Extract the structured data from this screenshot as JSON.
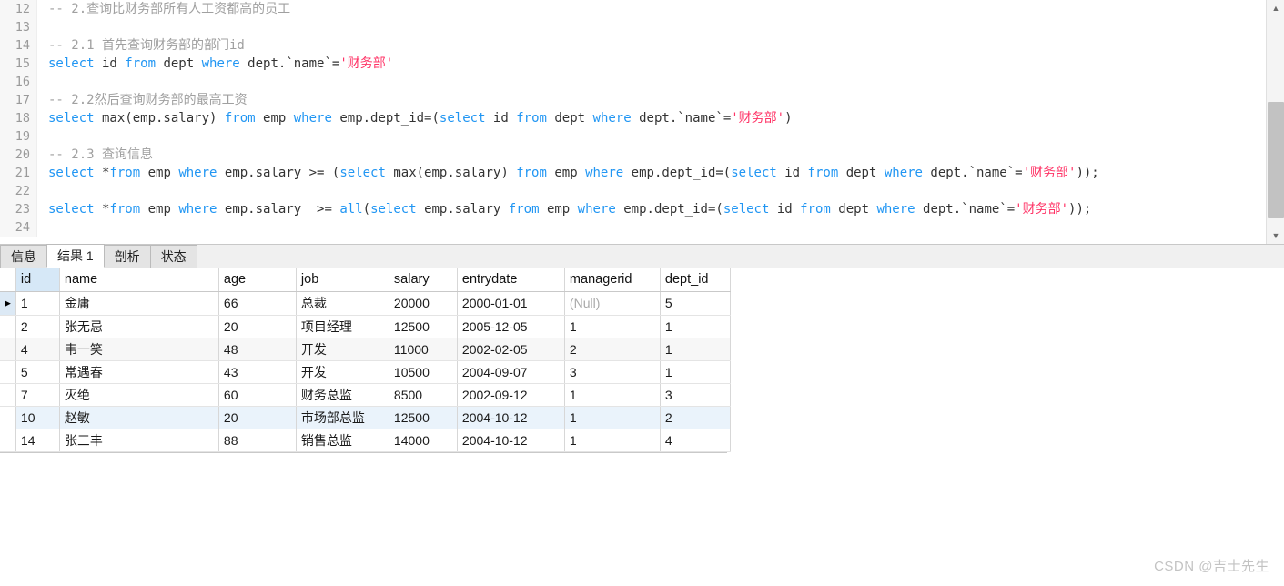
{
  "editor": {
    "first_line_number": 12,
    "lines": [
      {
        "n": 12,
        "tokens": [
          {
            "t": "cm",
            "s": "-- 2.查询比财务部所有人工资都高的员工"
          }
        ]
      },
      {
        "n": 13,
        "tokens": []
      },
      {
        "n": 14,
        "tokens": [
          {
            "t": "cm",
            "s": "-- 2.1 首先查询财务部的部门id"
          }
        ]
      },
      {
        "n": 15,
        "tokens": [
          {
            "t": "kw",
            "s": "select"
          },
          {
            "t": "plain",
            "s": " id "
          },
          {
            "t": "kw",
            "s": "from"
          },
          {
            "t": "plain",
            "s": " dept "
          },
          {
            "t": "kw",
            "s": "where"
          },
          {
            "t": "plain",
            "s": " dept.`name`="
          },
          {
            "t": "str",
            "s": "'财务部'"
          }
        ]
      },
      {
        "n": 16,
        "tokens": []
      },
      {
        "n": 17,
        "tokens": [
          {
            "t": "cm",
            "s": "-- 2.2然后查询财务部的最高工资"
          }
        ]
      },
      {
        "n": 18,
        "tokens": [
          {
            "t": "kw",
            "s": "select"
          },
          {
            "t": "plain",
            "s": " max(emp.salary) "
          },
          {
            "t": "kw",
            "s": "from"
          },
          {
            "t": "plain",
            "s": " emp "
          },
          {
            "t": "kw",
            "s": "where"
          },
          {
            "t": "plain",
            "s": " emp.dept_id=("
          },
          {
            "t": "kw",
            "s": "select"
          },
          {
            "t": "plain",
            "s": " id "
          },
          {
            "t": "kw",
            "s": "from"
          },
          {
            "t": "plain",
            "s": " dept "
          },
          {
            "t": "kw",
            "s": "where"
          },
          {
            "t": "plain",
            "s": " dept.`name`="
          },
          {
            "t": "str",
            "s": "'财务部'"
          },
          {
            "t": "plain",
            "s": ")"
          }
        ]
      },
      {
        "n": 19,
        "tokens": []
      },
      {
        "n": 20,
        "tokens": [
          {
            "t": "cm",
            "s": "-- 2.3 查询信息"
          }
        ]
      },
      {
        "n": 21,
        "tokens": [
          {
            "t": "kw",
            "s": "select"
          },
          {
            "t": "plain",
            "s": " *"
          },
          {
            "t": "kw",
            "s": "from"
          },
          {
            "t": "plain",
            "s": " emp "
          },
          {
            "t": "kw",
            "s": "where"
          },
          {
            "t": "plain",
            "s": " emp.salary >= ("
          },
          {
            "t": "kw",
            "s": "select"
          },
          {
            "t": "plain",
            "s": " max(emp.salary) "
          },
          {
            "t": "kw",
            "s": "from"
          },
          {
            "t": "plain",
            "s": " emp "
          },
          {
            "t": "kw",
            "s": "where"
          },
          {
            "t": "plain",
            "s": " emp.dept_id=("
          },
          {
            "t": "kw",
            "s": "select"
          },
          {
            "t": "plain",
            "s": " id "
          },
          {
            "t": "kw",
            "s": "from"
          },
          {
            "t": "plain",
            "s": " dept "
          },
          {
            "t": "kw",
            "s": "where"
          },
          {
            "t": "plain",
            "s": " dept.`name`="
          },
          {
            "t": "str",
            "s": "'财务部'"
          },
          {
            "t": "plain",
            "s": "));"
          }
        ]
      },
      {
        "n": 22,
        "tokens": []
      },
      {
        "n": 23,
        "tokens": [
          {
            "t": "kw",
            "s": "select"
          },
          {
            "t": "plain",
            "s": " *"
          },
          {
            "t": "kw",
            "s": "from"
          },
          {
            "t": "plain",
            "s": " emp "
          },
          {
            "t": "kw",
            "s": "where"
          },
          {
            "t": "plain",
            "s": " emp.salary  >= "
          },
          {
            "t": "kw",
            "s": "all"
          },
          {
            "t": "plain",
            "s": "("
          },
          {
            "t": "kw",
            "s": "select"
          },
          {
            "t": "plain",
            "s": " emp.salary "
          },
          {
            "t": "kw",
            "s": "from"
          },
          {
            "t": "plain",
            "s": " emp "
          },
          {
            "t": "kw",
            "s": "where"
          },
          {
            "t": "plain",
            "s": " emp.dept_id=("
          },
          {
            "t": "kw",
            "s": "select"
          },
          {
            "t": "plain",
            "s": " id "
          },
          {
            "t": "kw",
            "s": "from"
          },
          {
            "t": "plain",
            "s": " dept "
          },
          {
            "t": "kw",
            "s": "where"
          },
          {
            "t": "plain",
            "s": " dept.`name`="
          },
          {
            "t": "str",
            "s": "'财务部'"
          },
          {
            "t": "plain",
            "s": "));"
          }
        ]
      },
      {
        "n": 24,
        "tokens": []
      }
    ],
    "scroll_up_arrow": "▲",
    "scroll_down_arrow": "▼"
  },
  "tabs": [
    {
      "label": "信息",
      "active": false
    },
    {
      "label": "结果 1",
      "active": true
    },
    {
      "label": "剖析",
      "active": false
    },
    {
      "label": "状态",
      "active": false
    }
  ],
  "result_table": {
    "row_marker": "▶",
    "columns": [
      {
        "key": "id",
        "label": "id",
        "selected": true
      },
      {
        "key": "name",
        "label": "name",
        "selected": false
      },
      {
        "key": "age",
        "label": "age",
        "selected": false
      },
      {
        "key": "job",
        "label": "job",
        "selected": false
      },
      {
        "key": "salary",
        "label": "salary",
        "selected": false
      },
      {
        "key": "entrydate",
        "label": "entrydate",
        "selected": false
      },
      {
        "key": "managerid",
        "label": "managerid",
        "selected": false
      },
      {
        "key": "dept_id",
        "label": "dept_id",
        "selected": false
      }
    ],
    "null_text": "(Null)",
    "rows": [
      {
        "id": "1",
        "name": "金庸",
        "age": "66",
        "job": "总裁",
        "salary": "20000",
        "entrydate": "2000-01-01",
        "managerid": "(Null)",
        "dept_id": "5",
        "current": true,
        "highlight": false,
        "alt": false
      },
      {
        "id": "2",
        "name": "张无忌",
        "age": "20",
        "job": "项目经理",
        "salary": "12500",
        "entrydate": "2005-12-05",
        "managerid": "1",
        "dept_id": "1",
        "current": false,
        "highlight": false,
        "alt": false
      },
      {
        "id": "4",
        "name": "韦一笑",
        "age": "48",
        "job": "开发",
        "salary": "11000",
        "entrydate": "2002-02-05",
        "managerid": "2",
        "dept_id": "1",
        "current": false,
        "highlight": false,
        "alt": true
      },
      {
        "id": "5",
        "name": "常遇春",
        "age": "43",
        "job": "开发",
        "salary": "10500",
        "entrydate": "2004-09-07",
        "managerid": "3",
        "dept_id": "1",
        "current": false,
        "highlight": false,
        "alt": false
      },
      {
        "id": "7",
        "name": "灭绝",
        "age": "60",
        "job": "财务总监",
        "salary": "8500",
        "entrydate": "2002-09-12",
        "managerid": "1",
        "dept_id": "3",
        "current": false,
        "highlight": false,
        "alt": false
      },
      {
        "id": "10",
        "name": "赵敏",
        "age": "20",
        "job": "市场部总监",
        "salary": "12500",
        "entrydate": "2004-10-12",
        "managerid": "1",
        "dept_id": "2",
        "current": false,
        "highlight": true,
        "alt": false
      },
      {
        "id": "14",
        "name": "张三丰",
        "age": "88",
        "job": "销售总监",
        "salary": "14000",
        "entrydate": "2004-10-12",
        "managerid": "1",
        "dept_id": "4",
        "current": false,
        "highlight": false,
        "alt": false
      }
    ]
  },
  "watermark": {
    "text": "CSDN @吉士先生"
  },
  "colors": {
    "keyword": "#2196f3",
    "comment": "#a0a0a0",
    "string": "#ff3366",
    "selected_header": "#d6e8f7",
    "row_highlight": "#eaf3fb"
  }
}
